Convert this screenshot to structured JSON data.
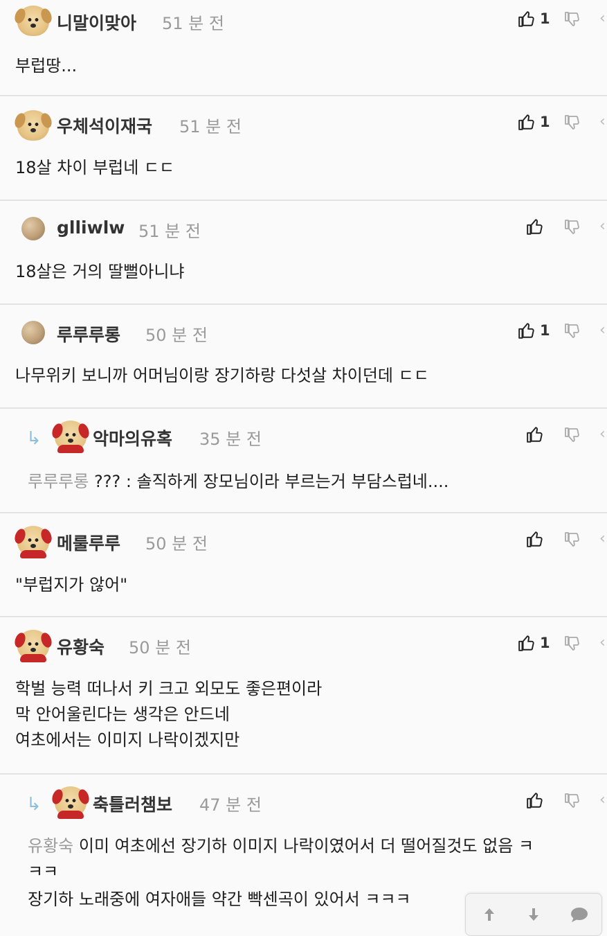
{
  "comments": [
    {
      "name": "니말이맞아",
      "time": "51 분 전",
      "upvotes": "1",
      "avatar": "dog",
      "lines": [
        "부럽땅..."
      ]
    },
    {
      "name": "우체석이재국",
      "time": "51 분 전",
      "upvotes": "1",
      "avatar": "dog",
      "lines": [
        "18살 차이 부럽네 ㄷㄷ"
      ]
    },
    {
      "name": "glliwlw",
      "time": "51 분 전",
      "upvotes": "",
      "avatar": "ball",
      "lines": [
        "18살은 거의 딸뻘아니냐"
      ]
    },
    {
      "name": "루루루롱",
      "time": "50 분 전",
      "upvotes": "1",
      "avatar": "ball",
      "lines": [
        "나무위키 보니까 어머님이랑 장기하랑 다섯살 차이던데 ㄷㄷ"
      ]
    },
    {
      "name": "악마의유혹",
      "time": "35 분 전",
      "upvotes": "",
      "avatar": "hood",
      "reply": true,
      "mention": "루루루롱",
      "lines": [
        "??? : 솔직하게 장모님이라 부르는거 부담스럽네...."
      ]
    },
    {
      "name": "메룰루루",
      "time": "50 분 전",
      "upvotes": "",
      "avatar": "hood",
      "lines": [
        "\"부럽지가 않어\""
      ]
    },
    {
      "name": "유황숙",
      "time": "50 분 전",
      "upvotes": "1",
      "avatar": "hood",
      "lines": [
        "학벌 능력 떠나서 키 크고 외모도 좋은편이라",
        "막 안어울린다는 생각은 안드네",
        "여초에서는 이미지 나락이겠지만"
      ]
    },
    {
      "name": "축틀러챔보",
      "time": "47 분 전",
      "upvotes": "",
      "avatar": "hood",
      "reply": true,
      "mention": "유황숙",
      "lines": [
        "이미 여초에선 장기하 이미지 나락이였어서 더 떨어질것도 없음 ㅋ",
        "ㅋㅋ",
        "장기하 노래중에 여자애들 약간 빡센곡이 있어서 ㅋㅋㅋ"
      ]
    }
  ],
  "bottom_bar": {
    "icons": [
      "arrow-up-icon",
      "arrow-down-icon",
      "chat-bubble-icon"
    ]
  },
  "colors": {
    "reply_arrow": "#8bc1de",
    "mention": "#9b9b9b",
    "divider": "#e3e3e3"
  }
}
